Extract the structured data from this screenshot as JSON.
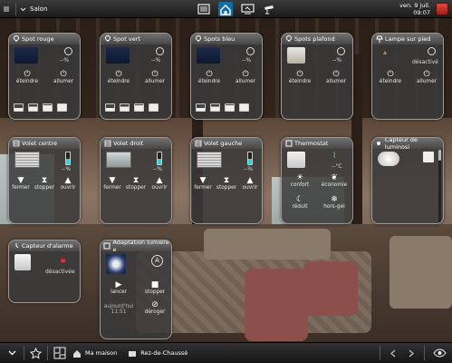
{
  "topbar": {
    "room": "Salon",
    "date": "ven. 9 juil.",
    "time": "09:07"
  },
  "bottombar": {
    "house": "Ma maison",
    "floor": "Rez-de-Chaussé"
  },
  "widgets": {
    "spot_rouge": {
      "title": "Spot rouge",
      "pct": "--%",
      "off": "éteindre",
      "on": "allumer"
    },
    "spot_vert": {
      "title": "Spot vert",
      "pct": "--%",
      "off": "éteindre",
      "on": "allumer"
    },
    "spots_bleu": {
      "title": "Spots  bleu",
      "pct": "--%",
      "off": "éteindre",
      "on": "allumer"
    },
    "spots_plafond": {
      "title": "Spots plafond",
      "pct": "--%",
      "off": "éteindre",
      "on": "allumer"
    },
    "lampe": {
      "title": "Lampe sur pied",
      "status": "désactivé",
      "off": "éteindre",
      "on": "allumer"
    },
    "volet_centre": {
      "title": "Volet centre",
      "pct": "--%",
      "close": "fermer",
      "stop": "stopper",
      "open": "ouvrir"
    },
    "volet_droit": {
      "title": "Volet droit",
      "pct": "--%",
      "close": "fermer",
      "stop": "stopper",
      "open": "ouvrir"
    },
    "volet_gauche": {
      "title": "Volet gauche",
      "pct": "--%",
      "close": "fermer",
      "stop": "stopper",
      "open": "ouvrir"
    },
    "thermostat": {
      "title": "Thermostat",
      "temp": "--°C",
      "comfort": "confort",
      "eco": "économie",
      "reduced": "réduit",
      "frost": "hors-gel"
    },
    "capteur_lum": {
      "title": "Capteur de luminosi"
    },
    "capteur_alarme": {
      "title": "Capteur d'alarme",
      "status": "désactivée"
    },
    "adaptation": {
      "title": "Adaptation lumière e",
      "start": "lancer",
      "stop": "stopper",
      "today": "aujourd'hui",
      "time": "11:51",
      "deregister": "déroger"
    }
  }
}
